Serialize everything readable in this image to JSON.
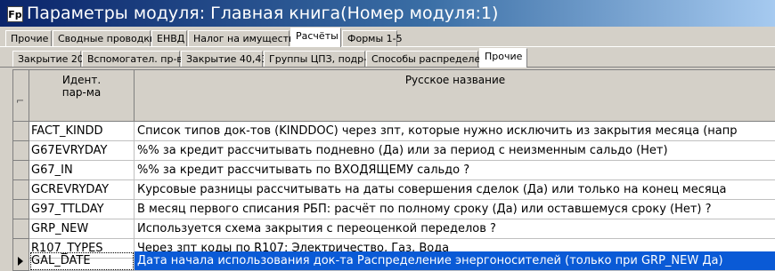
{
  "window": {
    "icon_text": "Fp",
    "title": "Параметры модуля: Главная книга(Номер модуля:1)"
  },
  "tabs_top": [
    {
      "label": "Прочие",
      "active": false
    },
    {
      "label": "Сводные проводки",
      "active": false
    },
    {
      "label": "ЕНВД",
      "active": false
    },
    {
      "label": "Налог на имущество",
      "active": false
    },
    {
      "label": "Расчёты",
      "active": true
    },
    {
      "label": "Формы 1-5",
      "active": false
    }
  ],
  "tabs_sub": [
    {
      "label": "Закрытие 20",
      "active": false
    },
    {
      "label": "Вспомогател. пр-ва",
      "active": false
    },
    {
      "label": "Закрытие 40,43",
      "active": false
    },
    {
      "label": "Группы ЦПЗ, подр-й",
      "active": false
    },
    {
      "label": "Способы распределен.",
      "active": false
    },
    {
      "label": "Прочие",
      "active": true
    }
  ],
  "grid": {
    "headers": {
      "code": "Идент.\nпар-ма",
      "name": "Русское название"
    },
    "rows": [
      {
        "code": "FACT_KINDD",
        "name": "Список типов док-тов (KINDDOC) через зпт, которые нужно исключить из закрытия месяца (напр",
        "selected": false
      },
      {
        "code": "G67EVRYDAY",
        "name": "%% за кредит рассчитывать подневно (Да)  или  за период с неизменным сальдо (Нет)",
        "selected": false
      },
      {
        "code": "G67_IN",
        "name": "%% за кредит рассчитывать по ВХОДЯЩЕМУ сальдо ?",
        "selected": false
      },
      {
        "code": "GCREVRYDAY",
        "name": "Курсовые разницы рассчитывать на даты совершения сделок (Да)  или  только на конец месяца",
        "selected": false
      },
      {
        "code": "G97_TTLDAY",
        "name": "В месяц первого списания РБП: расчёт по полному сроку (Да)   или   оставшемуся сроку (Нет) ?",
        "selected": false
      },
      {
        "code": "GRP_NEW",
        "name": "Используется схема закрытия с переоценкой переделов ?",
        "selected": false
      },
      {
        "code": "R107_TYPES",
        "name": "Через зпт коды по R107:  Электричество, Газ, Вода",
        "selected": false
      },
      {
        "code": "GAL_DATE",
        "name": "Дата начала использования док-та Распределение энергоносителей (только при GRP_NEW Да)",
        "selected": true
      }
    ]
  }
}
